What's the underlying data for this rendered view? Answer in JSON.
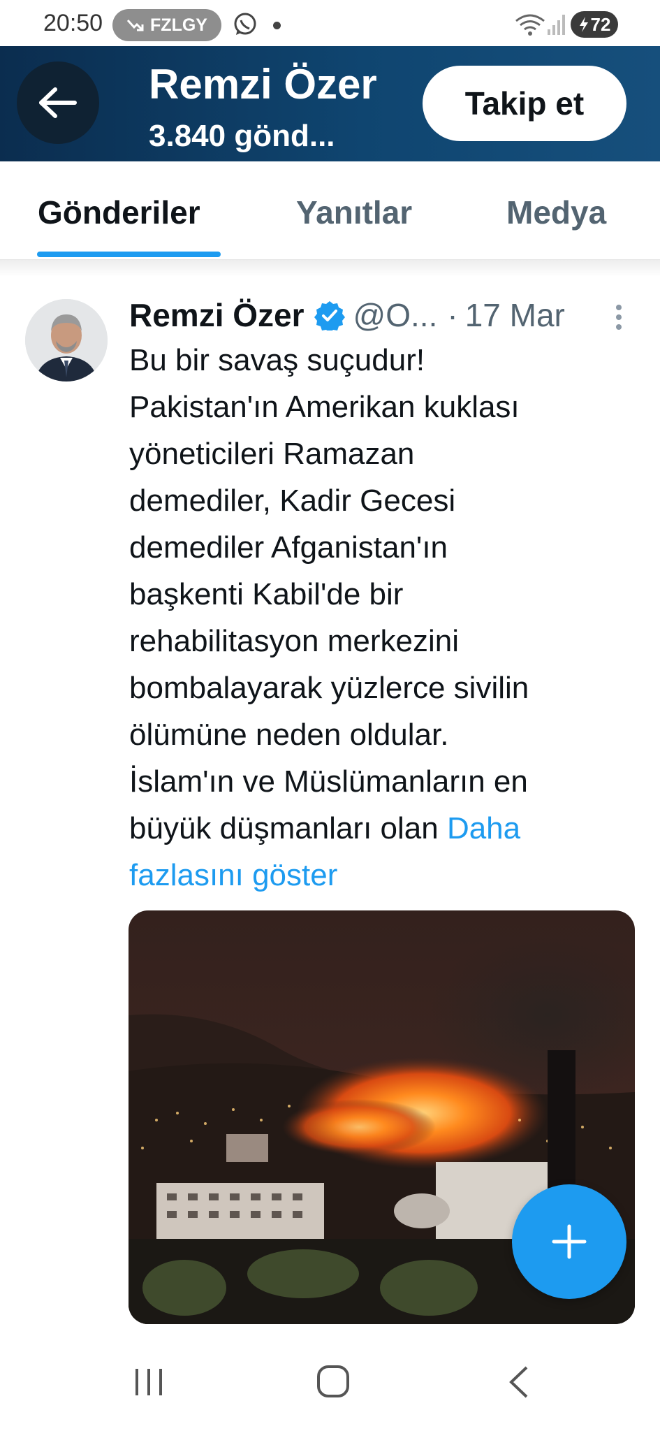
{
  "status_bar": {
    "time": "20:50",
    "notification_label": "FZLGY",
    "notification_icon": "trend-arrow-icon",
    "battery_level": "72",
    "icons": [
      "whatsapp-icon",
      "wifi-icon",
      "signal-icon",
      "battery-charging-icon"
    ]
  },
  "header": {
    "name": "Remzi Özer",
    "post_count": "3.840 gönd...",
    "follow_label": "Takip et",
    "background": "#0f4570"
  },
  "tabs": [
    {
      "label": "Gönderiler",
      "active": true
    },
    {
      "label": "Yanıtlar",
      "active": false
    },
    {
      "label": "Medya",
      "active": false
    }
  ],
  "tweet": {
    "author_name": "Remzi Özer",
    "handle": "@O...",
    "separator": "·",
    "date": "17 Mar",
    "verified": true,
    "lines": [
      "Bu bir savaş suçudur!",
      "Pakistan'ın Amerikan kuklası",
      "yöneticileri Ramazan",
      "demediler, Kadir Gecesi",
      "demediler Afganistan'ın",
      "başkenti Kabil'de bir",
      "rehabilitasyon merkezini",
      "bombalayarak yüzlerce sivilin",
      "ölümüne neden oldular.",
      "İslam'ın ve Müslümanların en"
    ],
    "last_line": "büyük düşmanları olan ",
    "show_more_label": "Daha fazlasını göster"
  },
  "colors": {
    "accent": "#1d9bf0",
    "text": "#0f1419",
    "muted": "#536471"
  }
}
